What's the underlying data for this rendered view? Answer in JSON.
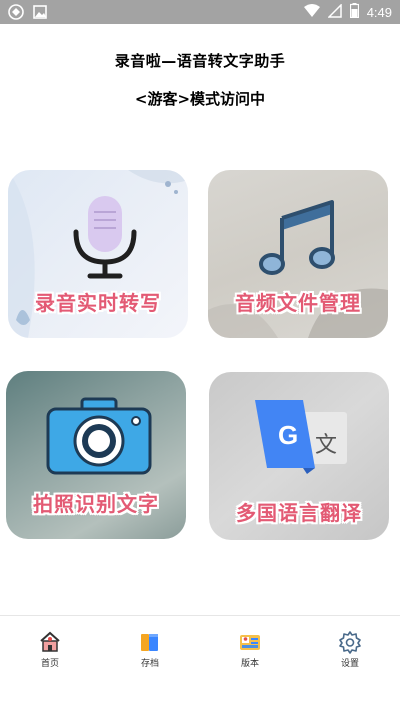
{
  "status_bar": {
    "time": "4:49",
    "icons": [
      "app-notification-icon",
      "image-notification-icon",
      "wifi-icon",
      "signal-icon",
      "battery-icon"
    ]
  },
  "header": {
    "app_title": "录音啦—语音转文字助手",
    "mode_text": "<游客>模式访问中"
  },
  "tiles": [
    {
      "label": "录音实时转写",
      "icon": "microphone-icon"
    },
    {
      "label": "音频文件管理",
      "icon": "music-note-icon"
    },
    {
      "label": "拍照识别文字",
      "icon": "camera-icon"
    },
    {
      "label": "多国语言翻译",
      "icon": "translate-icon"
    }
  ],
  "bottom_nav": {
    "items": [
      {
        "label": "首页",
        "icon": "home-icon"
      },
      {
        "label": "存档",
        "icon": "folder-icon"
      },
      {
        "label": "版本",
        "icon": "version-icon"
      },
      {
        "label": "设置",
        "icon": "gear-icon"
      }
    ]
  },
  "colors": {
    "label_pink": "#e35a74",
    "status_bar": "#a3a3a3",
    "camera_blue": "#3ea8e6",
    "note_blue": "#3f6e9b",
    "mic_purple": "#d9c9ef",
    "translate_blue": "#4285f4"
  }
}
